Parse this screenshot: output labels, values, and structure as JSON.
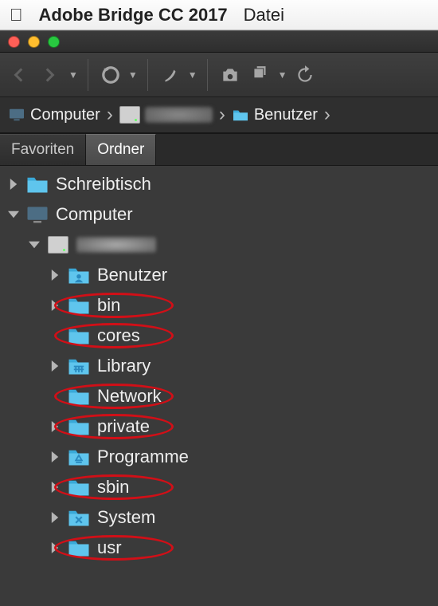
{
  "menubar": {
    "app_name": "Adobe Bridge CC 2017",
    "items": [
      "Datei"
    ]
  },
  "breadcrumbs": [
    {
      "kind": "computer",
      "label": "Computer"
    },
    {
      "kind": "hdd",
      "label": ""
    },
    {
      "kind": "folder",
      "label": "Benutzer"
    }
  ],
  "tabs": {
    "favorites": {
      "label": "Favoriten",
      "active": false
    },
    "folders": {
      "label": "Ordner",
      "active": true
    }
  },
  "tree": [
    {
      "depth": 0,
      "disclosure": "closed",
      "icon": "folder",
      "label": "Schreibtisch",
      "circled": false
    },
    {
      "depth": 0,
      "disclosure": "open",
      "icon": "computer",
      "label": "Computer",
      "circled": false
    },
    {
      "depth": 1,
      "disclosure": "open",
      "icon": "hdd",
      "label": "",
      "circled": false,
      "blur": true
    },
    {
      "depth": 2,
      "disclosure": "closed",
      "icon": "folder-user",
      "label": "Benutzer",
      "circled": false
    },
    {
      "depth": 2,
      "disclosure": "closed",
      "icon": "folder",
      "label": "bin",
      "circled": true
    },
    {
      "depth": 2,
      "disclosure": "none",
      "icon": "folder",
      "label": "cores",
      "circled": true
    },
    {
      "depth": 2,
      "disclosure": "closed",
      "icon": "folder-lib",
      "label": "Library",
      "circled": false
    },
    {
      "depth": 2,
      "disclosure": "none",
      "icon": "folder",
      "label": "Network",
      "circled": true
    },
    {
      "depth": 2,
      "disclosure": "closed",
      "icon": "folder",
      "label": "private",
      "circled": true
    },
    {
      "depth": 2,
      "disclosure": "closed",
      "icon": "folder-app",
      "label": "Programme",
      "circled": false
    },
    {
      "depth": 2,
      "disclosure": "closed",
      "icon": "folder",
      "label": "sbin",
      "circled": true
    },
    {
      "depth": 2,
      "disclosure": "closed",
      "icon": "folder-sys",
      "label": "System",
      "circled": false
    },
    {
      "depth": 2,
      "disclosure": "closed",
      "icon": "folder",
      "label": "usr",
      "circled": true
    }
  ],
  "colors": {
    "folder": "#5fc5ed",
    "highlight_ring": "#d10f17",
    "panel_bg": "#3a3a3a"
  }
}
